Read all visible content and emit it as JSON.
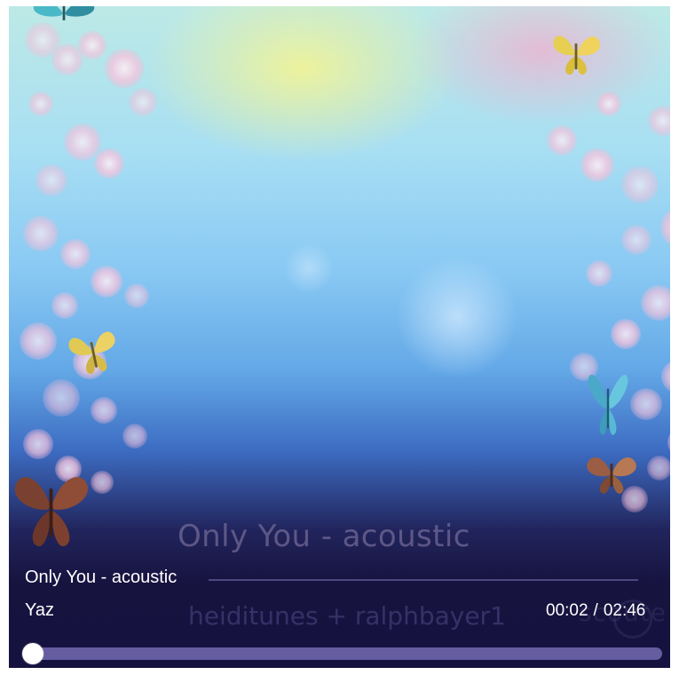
{
  "player": {
    "track_title": "Only You - acoustic",
    "artist": "Yaz",
    "overlay_title": "Only You - acoustic",
    "overlay_credits": "heiditunes + ralphbayer1",
    "current_time": "00:02",
    "duration": "02:46",
    "time_separator": "/",
    "progress_fraction": 0.012,
    "watermark_text": "scoute"
  },
  "colors": {
    "panel_bg": "#16123f",
    "progress_track": "#655d9f",
    "progress_fill": "#a9a4d3",
    "text": "#ffffff"
  },
  "icons": {
    "artwork": "cherry-blossom-butterfly-artwork",
    "progress_thumb": "progress-handle"
  }
}
